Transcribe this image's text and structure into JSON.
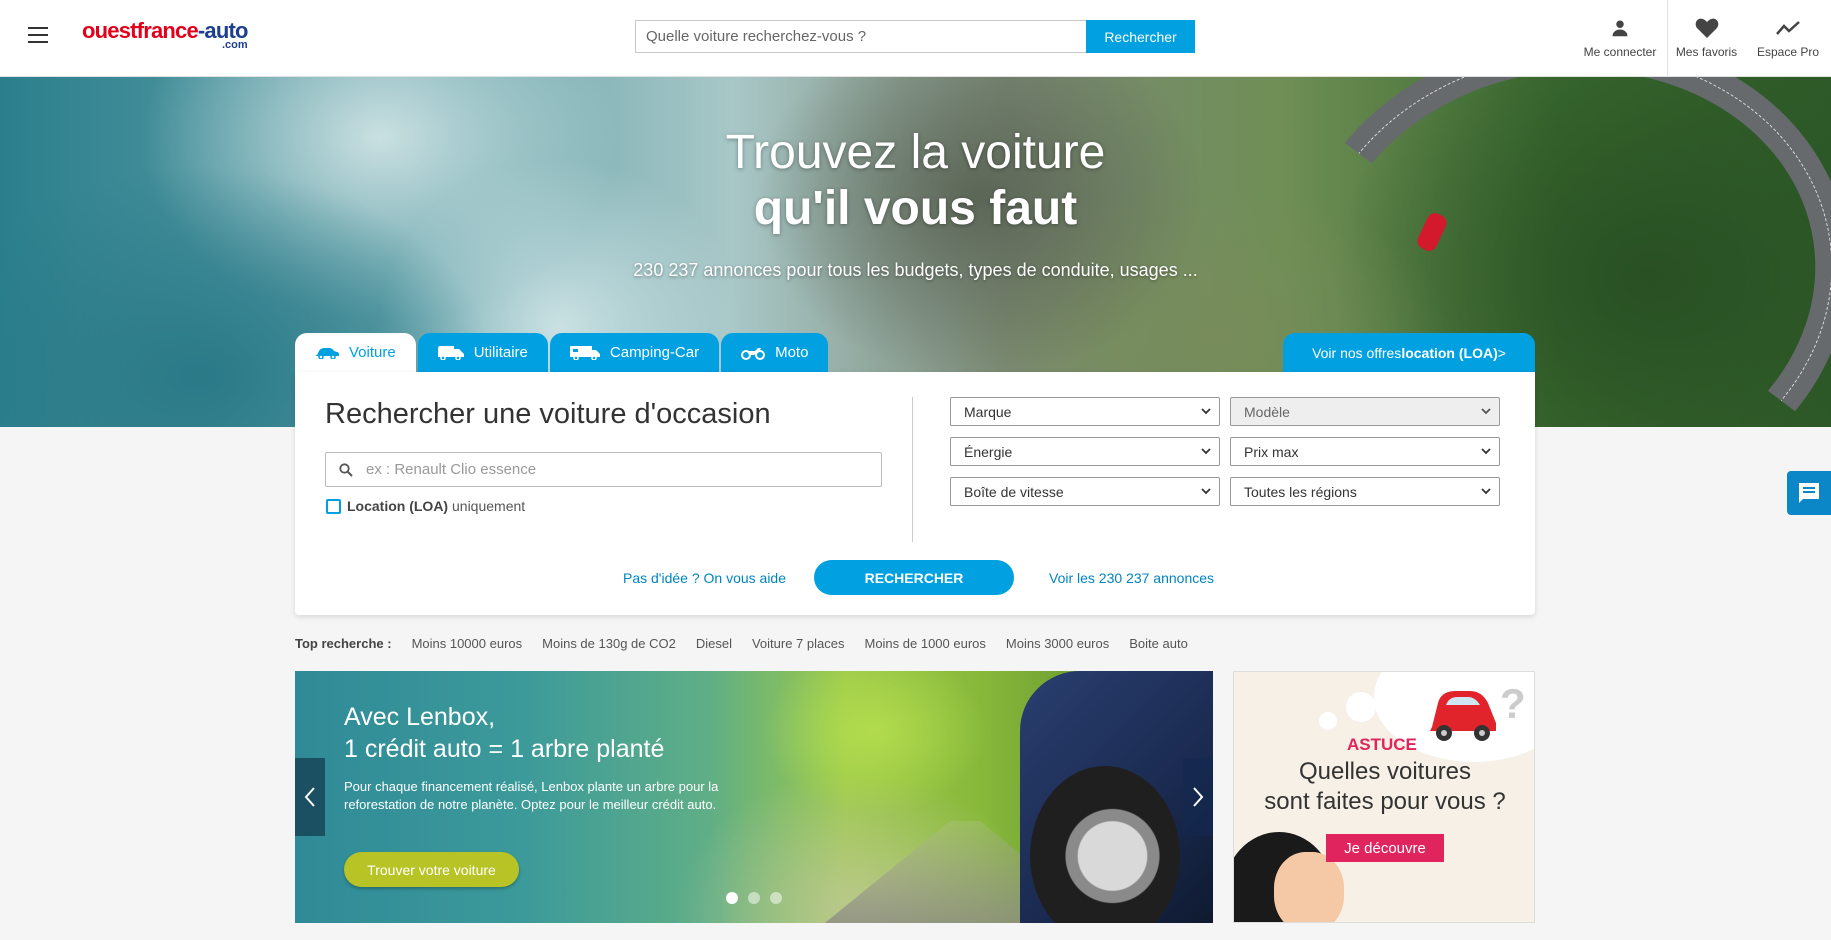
{
  "header": {
    "logo": {
      "part1": "ouestfrance",
      "part2": "-auto",
      "suffix": ".com"
    },
    "search": {
      "placeholder": "Quelle voiture recherchez-vous ?",
      "button": "Rechercher"
    },
    "actions": [
      {
        "label": "Me connecter",
        "icon": "user-icon"
      },
      {
        "label": "Mes favoris",
        "icon": "heart-icon"
      },
      {
        "label": "Espace Pro",
        "icon": "trend-icon"
      }
    ]
  },
  "hero": {
    "title_line1": "Trouvez la voiture",
    "title_line2": "qu'il vous faut",
    "subtitle": "230 237 annonces pour tous les budgets, types de conduite, usages ..."
  },
  "tabs": [
    {
      "label": "Voiture",
      "icon": "car-icon",
      "active": true
    },
    {
      "label": "Utilitaire",
      "icon": "van-icon",
      "active": false
    },
    {
      "label": "Camping-Car",
      "icon": "camper-icon",
      "active": false
    },
    {
      "label": "Moto",
      "icon": "moto-icon",
      "active": false
    }
  ],
  "loa_tab": {
    "text": "Voir nos offres ",
    "bold": "location (LOA)",
    "suffix": " >"
  },
  "search_card": {
    "title": "Rechercher une voiture d'occasion",
    "keyword_placeholder": "ex : Renault Clio essence",
    "loa_checkbox": {
      "bold": "Location (LOA)",
      "text": " uniquement",
      "checked": false
    },
    "selects": [
      {
        "value": "Marque",
        "disabled": false
      },
      {
        "value": "Modèle",
        "disabled": true
      },
      {
        "value": "Énergie",
        "disabled": false
      },
      {
        "value": "Prix max",
        "disabled": false
      },
      {
        "value": "Boîte de vitesse",
        "disabled": false
      },
      {
        "value": "Toutes les régions",
        "disabled": false
      }
    ],
    "help_link": "Pas d'idée ? On vous aide",
    "search_button": "RECHERCHER",
    "all_link": "Voir les 230 237 annonces"
  },
  "top_search": {
    "label": "Top recherche :",
    "items": [
      "Moins 10000 euros",
      "Moins de 130g de CO2",
      "Diesel",
      "Voiture 7 places",
      "Moins de 1000 euros",
      "Moins 3000 euros",
      "Boite auto"
    ]
  },
  "banner": {
    "title_line1": "Avec Lenbox,",
    "title_line2": "1 crédit auto = 1 arbre planté",
    "text": "Pour chaque financement réalisé, Lenbox plante un arbre pour la reforestation de notre planète. Optez pour le meilleur crédit auto.",
    "button": "Trouver votre voiture",
    "slides": 3,
    "active_slide": 1
  },
  "astuce": {
    "label": "ASTUCE",
    "question_line1": "Quelles voitures",
    "question_line2": "sont faites pour vous ?",
    "button": "Je découvre"
  },
  "colors": {
    "brand_blue": "#00a0e1",
    "brand_red": "#e2001a",
    "accent_pink": "#e0245e",
    "lenbox_green": "#b8c325"
  }
}
